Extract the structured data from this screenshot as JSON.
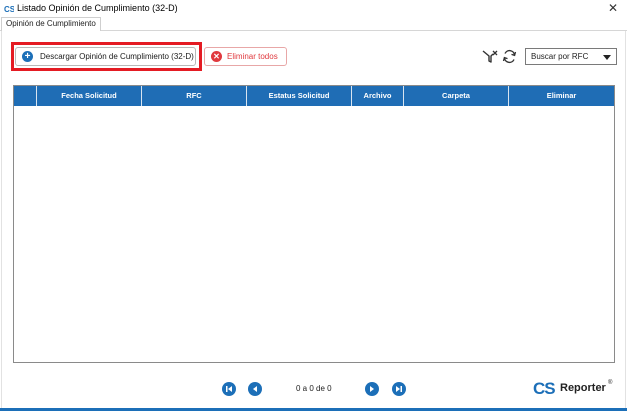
{
  "window": {
    "title": "Listado Opinión de Cumplimiento (32-D)",
    "close_glyph": "✕"
  },
  "tabs": [
    {
      "label": "Opinión de Cumplimiento"
    }
  ],
  "toolbar": {
    "download_label": "Descargar Opinión de Cumplimiento (32-D)",
    "download_icon": "plus-circle-icon",
    "delete_all_label": "Eliminar todos",
    "delete_all_icon": "x-circle-icon",
    "filter_icon": "clear-filter-icon",
    "refresh_icon": "refresh-icon",
    "search_select": {
      "value": "Buscar por RFC"
    }
  },
  "table": {
    "columns": [
      "",
      "Fecha Solicitud",
      "RFC",
      "Estatus Solicitud",
      "Archivo",
      "Carpeta",
      "Eliminar"
    ],
    "rows": []
  },
  "pager": {
    "status": "0 a 0 de 0"
  },
  "brand": {
    "cs": "CS",
    "name": "Reporter",
    "reg": "®"
  },
  "colors": {
    "accent": "#1c6fb8",
    "header_bg": "#1f6db5",
    "highlight": "#e41b23",
    "danger": "#e0393e"
  }
}
